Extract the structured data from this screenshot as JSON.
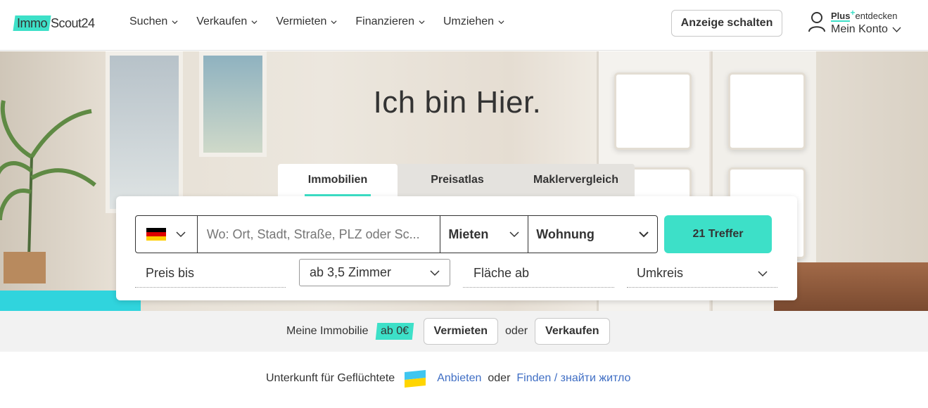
{
  "header": {
    "logo": {
      "part1": "Immo",
      "part2": "Scout24"
    },
    "nav": [
      {
        "label": "Suchen"
      },
      {
        "label": "Verkaufen"
      },
      {
        "label": "Vermieten"
      },
      {
        "label": "Finanzieren"
      },
      {
        "label": "Umziehen"
      }
    ],
    "anzeige_button": "Anzeige schalten",
    "account": {
      "plus": "Plus",
      "plus_sup": "+",
      "entdecken": "entdecken",
      "konto": "Mein Konto"
    }
  },
  "hero": {
    "title": "Ich bin Hier."
  },
  "tabs": [
    {
      "label": "Immobilien",
      "active": true
    },
    {
      "label": "Preisatlas",
      "active": false
    },
    {
      "label": "Maklervergleich",
      "active": false
    }
  ],
  "search": {
    "country_flag": "germany-flag-icon",
    "where_placeholder": "Wo: Ort, Stadt, Straße, PLZ oder Sc...",
    "mode": "Mieten",
    "type": "Wohnung",
    "results_button": "21 Treffer",
    "preis": "Preis bis",
    "zimmer": "ab 3,5 Zimmer",
    "flaeche": "Fläche ab",
    "umkreis": "Umkreis"
  },
  "strip": {
    "meine": "Meine Immobilie",
    "badge": "ab 0€",
    "vermieten": "Vermieten",
    "oder": "oder",
    "verkaufen": "Verkaufen"
  },
  "bottom": {
    "text": "Unterkunft für Geflüchtete",
    "anbieten": "Anbieten",
    "oder": "oder",
    "finden": "Finden / знайти житло"
  },
  "colors": {
    "accent": "#3de0c8",
    "link": "#3f6ec4",
    "text": "#333333"
  }
}
